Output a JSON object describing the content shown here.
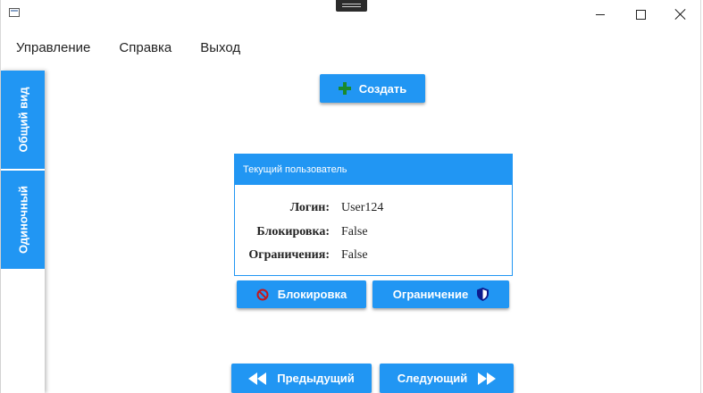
{
  "menu": {
    "items": [
      "Управление",
      "Справка",
      "Выход"
    ]
  },
  "tabs": [
    {
      "label": "Общий вид"
    },
    {
      "label": "Одиночный"
    }
  ],
  "toolbar": {
    "create_label": "Создать"
  },
  "user_card": {
    "header": "Текущий пользователь",
    "fields": [
      {
        "label": "Логин:",
        "value": "User124"
      },
      {
        "label": "Блокировка:",
        "value": "False"
      },
      {
        "label": "Ограничения:",
        "value": "False"
      }
    ]
  },
  "actions": {
    "block_label": "Блокировка",
    "restrict_label": "Ограничение"
  },
  "pager": {
    "prev_label": "Предыдущий",
    "next_label": "Следующий"
  },
  "icons": {
    "create": "plus-icon",
    "block": "block-icon",
    "restrict": "shield-icon",
    "prev": "rewind-icon",
    "next": "fast-forward-icon"
  },
  "colors": {
    "accent": "#2196f3",
    "plus": "#1a8a2c",
    "block_icon": "#c3161c",
    "shield_icon": "#0d1b8e"
  }
}
